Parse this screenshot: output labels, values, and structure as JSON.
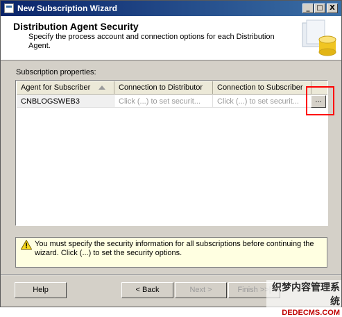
{
  "window": {
    "title": "New Subscription Wizard",
    "controls": {
      "minimize": "_",
      "maximize": "□",
      "close": "X"
    }
  },
  "header": {
    "title": "Distribution Agent Security",
    "description": "Specify the process account and connection options for each Distribution Agent.",
    "graphic_icon": "database-wizard-icon"
  },
  "subscription_properties": {
    "label": "Subscription properties:",
    "columns": [
      "Agent for Subscriber",
      "Connection to Distributor",
      "Connection to Subscriber"
    ],
    "rows": [
      {
        "agent": "CNBLOGSWEB3",
        "distributor": "Click (...) to set securit...",
        "subscriber": "Click (...) to set securit..."
      }
    ],
    "ellipsis_button": "...",
    "sort_icon": "sort-ascending-icon"
  },
  "warning": {
    "icon": "warning-icon",
    "text": "You must specify the security information for all subscriptions before continuing the wizard. Click (...) to set the security options."
  },
  "buttons": {
    "help": "Help",
    "back": "< Back",
    "next": "Next >",
    "finish": "Finish >>|"
  },
  "watermark": {
    "line1": "织梦内容管理系统",
    "line2": "DEDECMS.COM"
  },
  "colors": {
    "title_gradient_start": "#0a246a",
    "title_gradient_end": "#3a6ea5",
    "highlight": "#ff0000",
    "warning_bg": "#ffffe1"
  }
}
